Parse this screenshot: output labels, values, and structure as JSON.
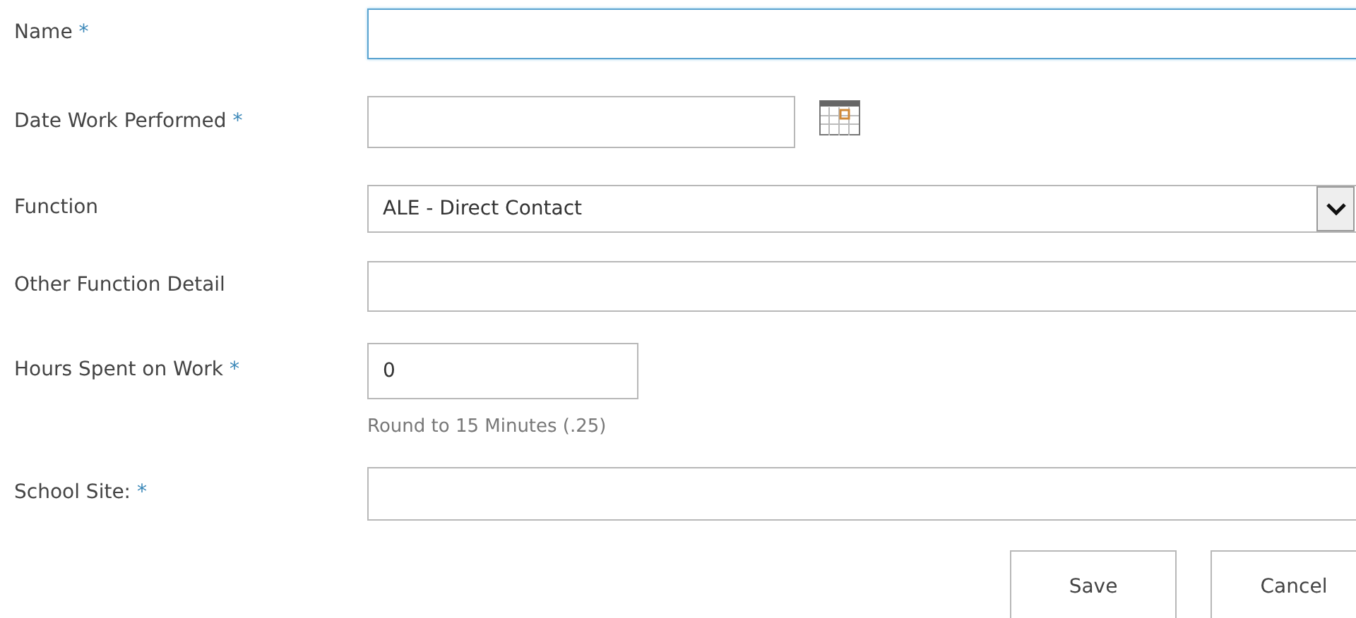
{
  "fields": [
    {
      "kind": "text",
      "label": "Name",
      "required": true,
      "focused": true
    },
    {
      "kind": "date",
      "label": "Date Work Performed",
      "required": true,
      "focused": false
    },
    {
      "kind": "select",
      "label": "Function",
      "required": false,
      "focused": false,
      "value": "ALE - Direct Contact"
    },
    {
      "kind": "text",
      "label": "Other Function Detail",
      "required": false,
      "focused": false
    },
    {
      "kind": "number",
      "label": "Hours Spent on Work",
      "required": true,
      "focused": false,
      "value": "0",
      "hint": "Round to 15 Minutes (.25)"
    },
    {
      "kind": "text",
      "label": "School Site:",
      "required": true,
      "focused": false
    }
  ],
  "required_mark": "*",
  "buttons": [
    "Save",
    "Cancel"
  ]
}
